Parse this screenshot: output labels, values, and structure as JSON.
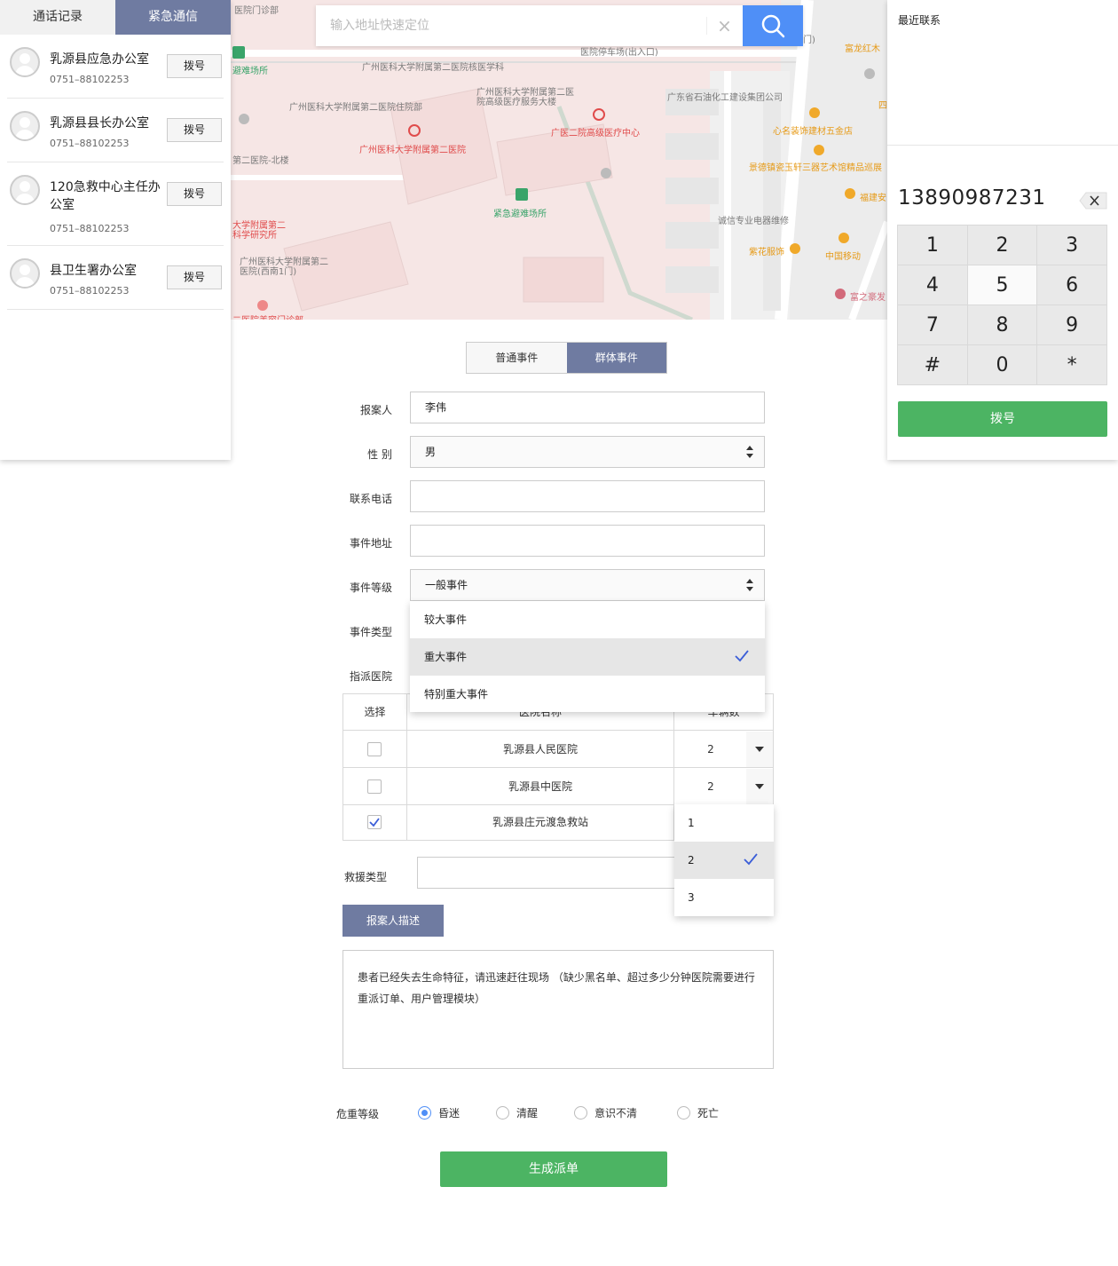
{
  "search": {
    "placeholder": "输入地址快速定位"
  },
  "left_panel": {
    "tabs": [
      "通话记录",
      "紧急通信"
    ],
    "contacts": [
      {
        "name": "乳源县应急办公室",
        "phone": "0751–88102253",
        "action": "拨号"
      },
      {
        "name": "乳源县县长办公室",
        "phone": "0751–88102253",
        "action": "拨号"
      },
      {
        "name": "120急救中心主任办公室",
        "phone": "0751–88102253",
        "action": "拨号"
      },
      {
        "name": "县卫生署办公室",
        "phone": "0751–88102253",
        "action": "拨号"
      }
    ]
  },
  "map": {
    "labels": [
      "医院门诊部",
      "避难场所",
      "广州医科大学附属第二医院核医学科",
      "广州医科大学附属第二医院住院部",
      "广州医科大学附属第二医院",
      "广州医科大学附属第二医院高级医疗服务大楼",
      "广医二院高级医疗中心",
      "广东省石油化工建设集团公司",
      "心名装饰建材五金店",
      "景德镇瓷玉轩三器艺术馆精品巡展",
      "紧急避难场所",
      "诚信专业电器维修",
      "紫花服饰",
      "中国移动",
      "福建安",
      "富之豪发",
      "富龙红木",
      "医院停车场(出入口)",
      "第二医院-北楼",
      "大学附属第二",
      "科学研究所",
      "广州医科大学附属第二医院(西南1门)",
      "二医院美容门诊部",
      "门)",
      "四"
    ]
  },
  "dialer": {
    "recent_label": "最近联系",
    "number": "13890987231",
    "keys": [
      "1",
      "2",
      "3",
      "4",
      "5",
      "6",
      "7",
      "8",
      "9",
      "#",
      "0",
      "*"
    ],
    "call_label": "拨号"
  },
  "form": {
    "event_tabs": [
      "普通事件",
      "群体事件"
    ],
    "reporter_label": "报案人",
    "reporter_value": "李伟",
    "gender_label": "性 别",
    "gender_value": "男",
    "phone_label": "联系电话",
    "address_label": "事件地址",
    "level_label": "事件等级",
    "level_value": "一般事件",
    "level_options": [
      "较大事件",
      "重大事件",
      "特别重大事件"
    ],
    "type_label": "事件类型",
    "hospital_label": "指派医院",
    "table_headers": [
      "选择",
      "医院名称",
      "车辆数"
    ],
    "hospitals": [
      {
        "name": "乳源县人民医院",
        "count": "2",
        "checked": false
      },
      {
        "name": "乳源县中医院",
        "count": "2",
        "checked": false
      },
      {
        "name": "乳源县庄元渡急救站",
        "count": "",
        "checked": true
      }
    ],
    "count_options": [
      "1",
      "2",
      "3"
    ],
    "rescue_label": "救援类型",
    "desc_button": "报案人描述",
    "description": "患者已经失去生命特征，请迅速赶往现场 （缺少黑名单、超过多少分钟医院需要进行重派订单、用户管理模块）",
    "severity_label": "危重等级",
    "severity_options": [
      "昏迷",
      "清醒",
      "意识不清",
      "死亡"
    ],
    "submit": "生成派单"
  },
  "colors": {
    "accent_purple": "#6f7ba1",
    "green": "#4cb463",
    "blue": "#4f8ff7"
  }
}
